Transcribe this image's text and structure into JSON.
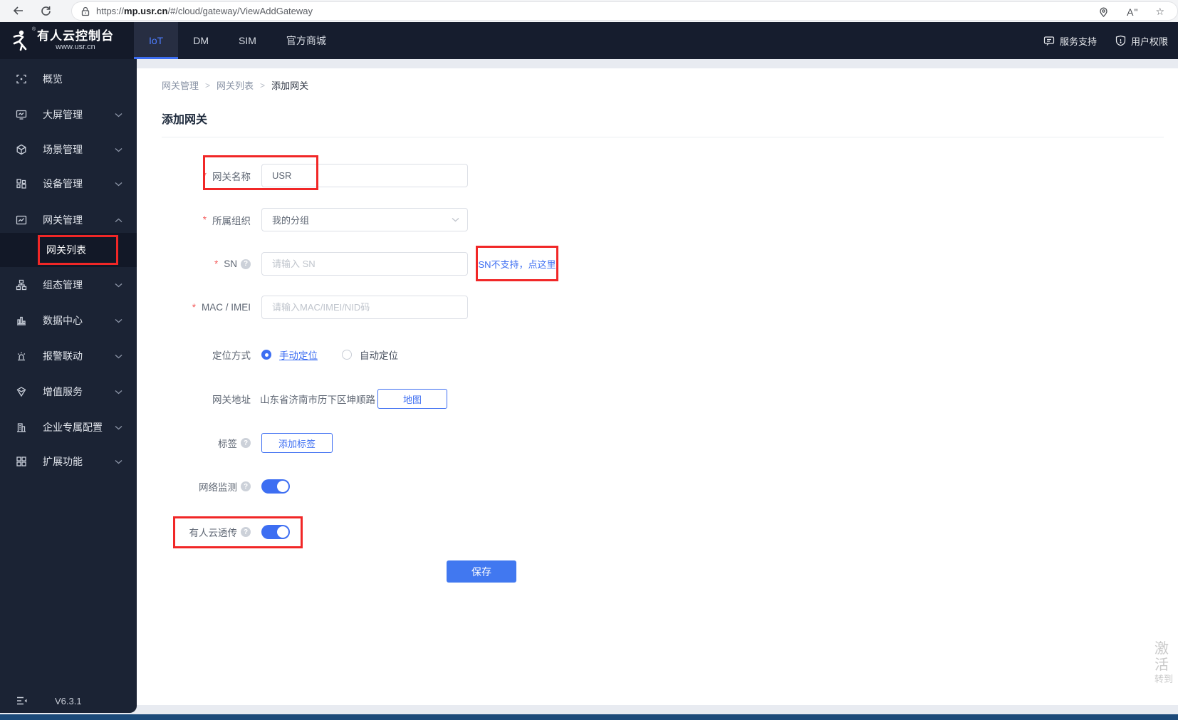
{
  "browser": {
    "url_scheme": "https://",
    "url_host": "mp.usr.cn",
    "url_path": "/#/cloud/gateway/ViewAddGateway",
    "readaloud_glyph": "Aʺ",
    "star_glyph": "☆"
  },
  "header": {
    "brand_title": "有人云控制台",
    "brand_subtitle": "www.usr.cn",
    "brand_mark": "®",
    "tabs": [
      {
        "label": "IoT"
      },
      {
        "label": "DM"
      },
      {
        "label": "SIM"
      },
      {
        "label": "官方商城"
      }
    ],
    "support_label": "服务支持",
    "permission_label": "用户权限"
  },
  "sidebar": {
    "items": [
      {
        "label": "概览"
      },
      {
        "label": "大屏管理"
      },
      {
        "label": "场景管理"
      },
      {
        "label": "设备管理"
      },
      {
        "label": "网关管理"
      },
      {
        "label": "组态管理"
      },
      {
        "label": "数据中心"
      },
      {
        "label": "报警联动"
      },
      {
        "label": "增值服务"
      },
      {
        "label": "企业专属配置"
      },
      {
        "label": "扩展功能"
      }
    ],
    "submenu": {
      "label": "网关列表"
    },
    "version": "V6.3.1"
  },
  "main": {
    "breadcrumb": {
      "0": "网关管理",
      "1": "网关列表",
      "2": "添加网关"
    },
    "title": "添加网关",
    "form": {
      "gateway_name": {
        "label": "网关名称",
        "value": "USR"
      },
      "organization": {
        "label": "所属组织",
        "value": "我的分组"
      },
      "sn": {
        "label": "SN",
        "placeholder": "请输入 SN",
        "help_link": "SN不支持，点这里"
      },
      "mac": {
        "label": "MAC / IMEI",
        "placeholder": "请输入MAC/IMEI/NID码"
      },
      "positioning": {
        "label": "定位方式",
        "options": {
          "0": {
            "label": "手动定位"
          },
          "1": {
            "label": "自动定位"
          }
        }
      },
      "address": {
        "label": "网关地址",
        "value": "山东省济南市历下区坤顺路",
        "map_button": "地图"
      },
      "tags": {
        "label": "标签",
        "add_button": "添加标签"
      },
      "network_monitor": {
        "label": "网络监测"
      },
      "cloud_passthrough": {
        "label": "有人云透传"
      },
      "save_button": "保存"
    }
  },
  "watermark": {
    "line1": "激活",
    "line2": "转到"
  },
  "colors": {
    "accent": "#3d6ef2",
    "highlight": "#f12727",
    "header_bg": "#161d2e",
    "sidebar_bg": "#1b2334",
    "bottom_bar": "#1c4a79"
  }
}
